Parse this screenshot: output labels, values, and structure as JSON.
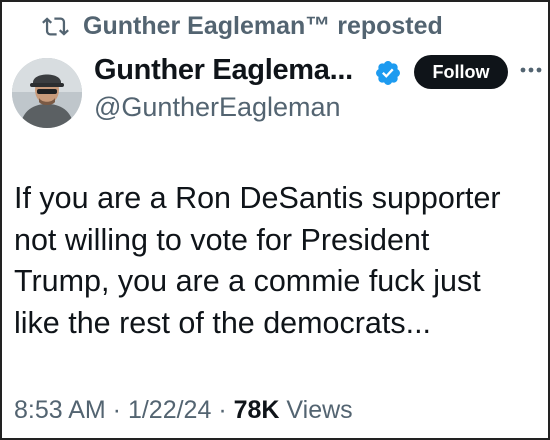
{
  "repost": {
    "text": "Gunther Eagleman™ reposted"
  },
  "author": {
    "display_name": "Gunther Eaglema...",
    "handle": "@GuntherEagleman",
    "follow_label": "Follow"
  },
  "tweet": {
    "lines": [
      "If you are a Ron DeSantis supporter",
      "not willing to vote for President",
      "Trump,  you are a commie fuck just",
      "like the rest of the democrats..."
    ]
  },
  "meta": {
    "time": "8:53 AM",
    "sep1": " · ",
    "date": "1/22/24",
    "sep2": " · ",
    "views_count": "78K",
    "views_label": " Views"
  },
  "icons": {
    "repost": "repost-icon",
    "verified": "verified-badge-icon",
    "more": "more-options-icon"
  },
  "colors": {
    "verified": "#1d9bf0",
    "secondary_text": "#536471",
    "follow_button": "#0f1419"
  }
}
